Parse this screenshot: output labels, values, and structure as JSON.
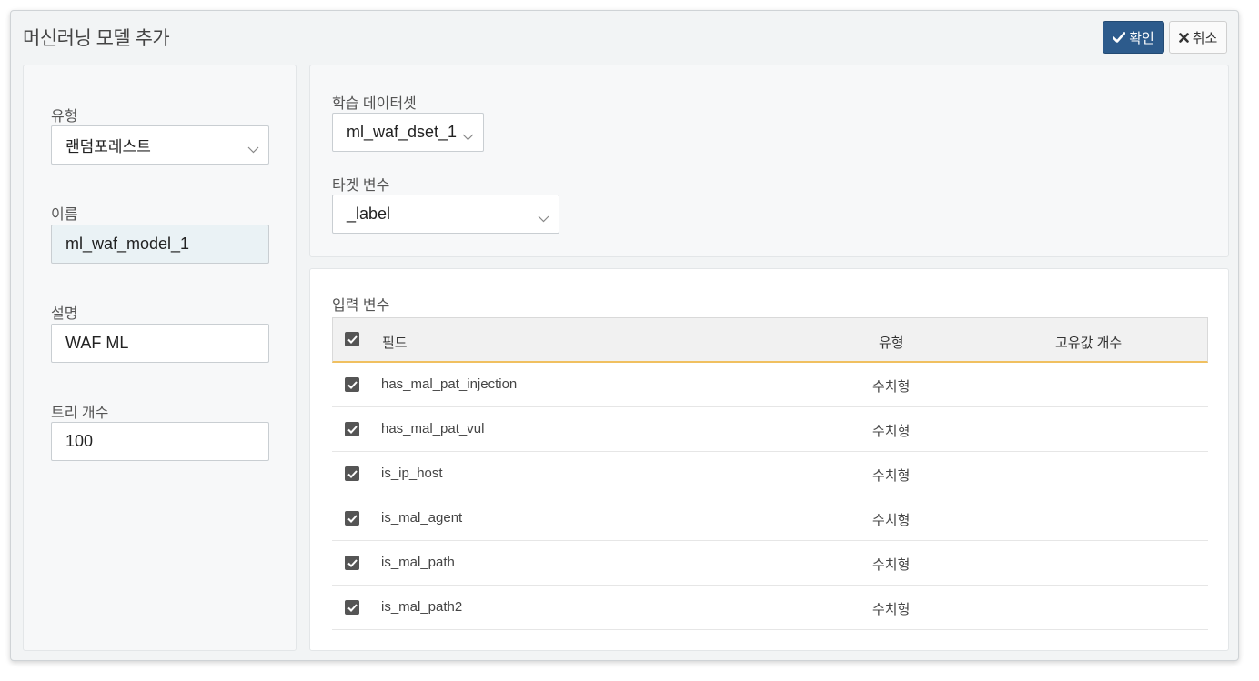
{
  "dialog": {
    "title": "머신러닝 모델 추가",
    "confirm_label": "확인",
    "cancel_label": "취소"
  },
  "form": {
    "type_label": "유형",
    "type_value": "랜덤포레스트",
    "name_label": "이름",
    "name_value": "ml_waf_model_1",
    "desc_label": "설명",
    "desc_value": "WAF ML",
    "trees_label": "트리 개수",
    "trees_value": "100",
    "dataset_label": "학습 데이터셋",
    "dataset_value": "ml_waf_dset_1",
    "target_label": "타겟 변수",
    "target_value": "_label"
  },
  "inputs": {
    "title": "입력 변수",
    "columns": [
      "필드",
      "유형",
      "고유값 개수"
    ],
    "rows": [
      {
        "field": "has_mal_pat_injection",
        "type": "수치형",
        "checked": true
      },
      {
        "field": "has_mal_pat_vul",
        "type": "수치형",
        "checked": true
      },
      {
        "field": "is_ip_host",
        "type": "수치형",
        "checked": true
      },
      {
        "field": "is_mal_agent",
        "type": "수치형",
        "checked": true
      },
      {
        "field": "is_mal_path",
        "type": "수치형",
        "checked": true
      },
      {
        "field": "is_mal_path2",
        "type": "수치형",
        "checked": true
      }
    ]
  },
  "colors": {
    "primary": "#2d5b8c",
    "header_underline": "#f0c060"
  }
}
